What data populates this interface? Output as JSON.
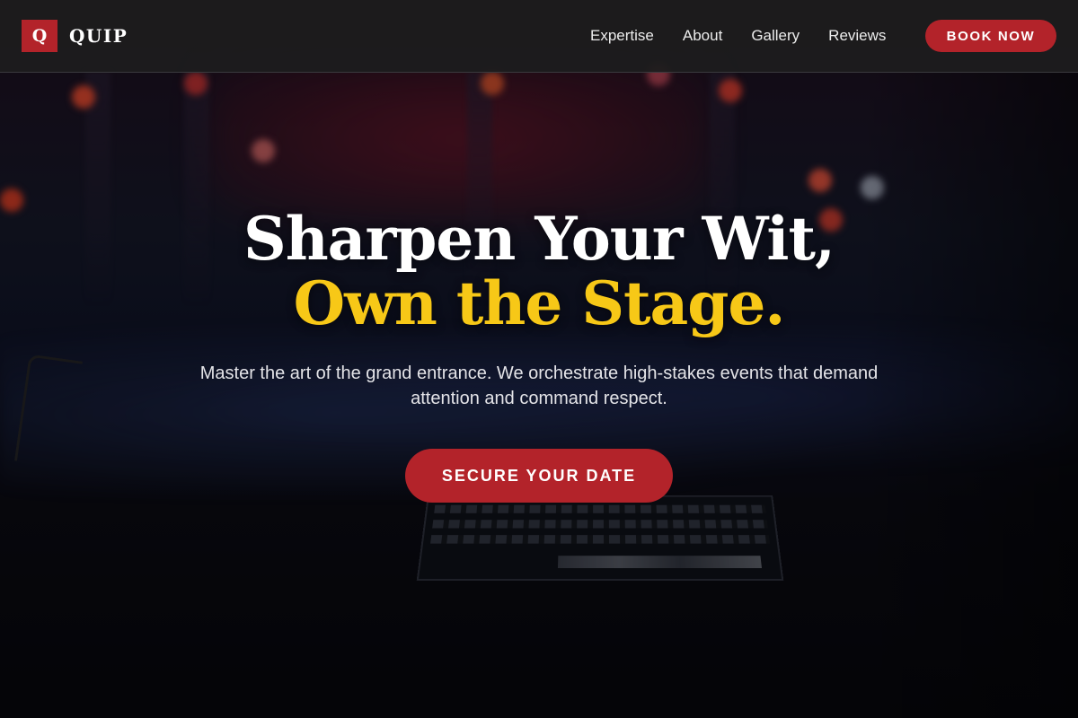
{
  "brand": {
    "mark": "Q",
    "name": "QUIP"
  },
  "nav": {
    "links": [
      "Expertise",
      "About",
      "Gallery",
      "Reviews"
    ],
    "book_label": "BOOK NOW"
  },
  "hero": {
    "headline_main": "Sharpen Your Wit, ",
    "headline_accent": "Own the Stage.",
    "subtitle": "Master the art of the grand entrance. We orchestrate high-stakes events that demand attention and command respect.",
    "cta_label": "SECURE YOUR DATE"
  },
  "colors": {
    "accent_red": "#b3232a",
    "accent_gold": "#f7c817",
    "nav_bg": "#1c1c1e"
  },
  "background": {
    "semantic": "blurred-concert-stage-with-mixing-console"
  }
}
